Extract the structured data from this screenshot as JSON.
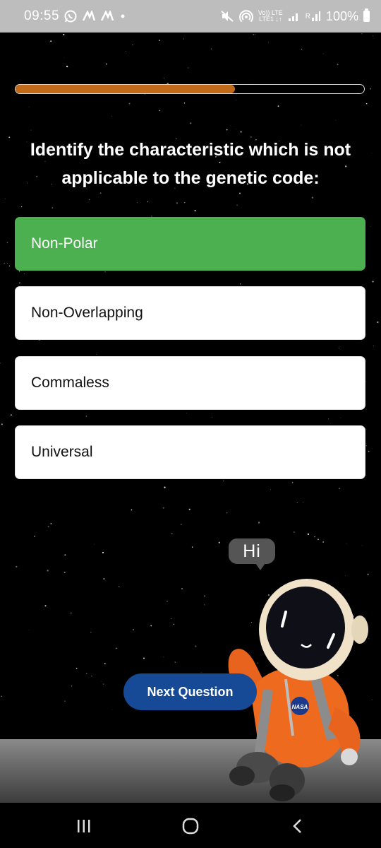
{
  "status_bar": {
    "time": "09:55",
    "network_top": "Vo)) LTE",
    "network_bottom": "LTE1 ↓↑",
    "network_r": "R",
    "battery": "100%",
    "icons": [
      "whatsapp-icon",
      "app-notification-icon",
      "app-notification-icon",
      "dot-icon",
      "mute-icon",
      "wifi-hotspot-icon",
      "signal-icon",
      "battery-icon"
    ]
  },
  "quiz": {
    "progress": 0.63,
    "question": "Identify the characteristic which is not applicable to the genetic code:",
    "options": [
      {
        "label": "Non-Polar",
        "selected": true
      },
      {
        "label": "Non-Overlapping",
        "selected": false
      },
      {
        "label": "Commaless",
        "selected": false
      },
      {
        "label": "Universal",
        "selected": false
      }
    ],
    "next_button": "Next Question"
  },
  "mascot": {
    "speech": "Hi",
    "badge": "NASA"
  },
  "colors": {
    "progress_fill": "#c06a1a",
    "selected_option": "#4caf50",
    "next_button": "#164a96",
    "status_bar": "#bdbdbd"
  },
  "nav_bar": {
    "icons": [
      "recent-apps-icon",
      "home-icon",
      "back-icon"
    ]
  }
}
